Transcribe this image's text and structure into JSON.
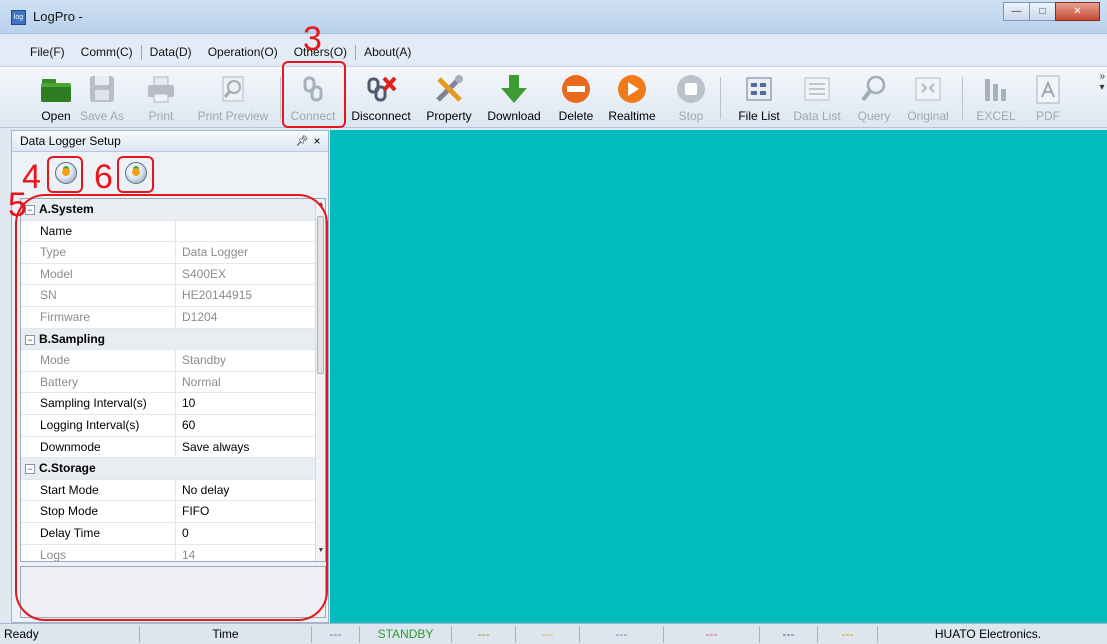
{
  "window": {
    "title": "LogPro -",
    "app_icon_text": "log"
  },
  "menu": [
    "File(F)",
    "Comm(C)",
    "Data(D)",
    "Operation(O)",
    "Others(O)",
    "About(A)"
  ],
  "toolbar": {
    "open": "Open",
    "save_as": "Save As",
    "print": "Print",
    "print_preview": "Print Preview",
    "connect": "Connect",
    "disconnect": "Disconnect",
    "property": "Property",
    "download": "Download",
    "delete": "Delete",
    "realtime": "Realtime",
    "stop": "Stop",
    "file_list": "File List",
    "data_list": "Data List",
    "query": "Query",
    "original": "Original",
    "excel": "EXCEL",
    "pdf": "PDF"
  },
  "panel": {
    "title": "Data Logger Setup"
  },
  "grid": {
    "rows": [
      {
        "k": "A.System",
        "cat": true
      },
      {
        "k": "Name",
        "v": ""
      },
      {
        "k": "Type",
        "v": "Data Logger",
        "ro": true
      },
      {
        "k": "Model",
        "v": "S400EX",
        "ro": true
      },
      {
        "k": "SN",
        "v": "HE20144915",
        "ro": true
      },
      {
        "k": "Firmware",
        "v": "D1204",
        "ro": true
      },
      {
        "k": "B.Sampling",
        "cat": true
      },
      {
        "k": "Mode",
        "v": "Standby",
        "ro": true
      },
      {
        "k": "Battery",
        "v": "Normal",
        "ro": true
      },
      {
        "k": "Sampling Interval(s)",
        "v": "10"
      },
      {
        "k": "Logging Interval(s)",
        "v": "60"
      },
      {
        "k": "Downmode",
        "v": "Save always"
      },
      {
        "k": "C.Storage",
        "cat": true
      },
      {
        "k": "Start Mode",
        "v": "No delay"
      },
      {
        "k": "Stop Mode",
        "v": "FIFO"
      },
      {
        "k": "Delay Time",
        "v": "0"
      },
      {
        "k": "Logs",
        "v": "14",
        "ro": true
      }
    ]
  },
  "status": {
    "ready": "Ready",
    "time": "Time",
    "d1": "---",
    "standby": "STANDBY",
    "d2": "---",
    "d3": "---",
    "d4": "---",
    "d5": "---",
    "d6": "---",
    "d7": "---",
    "company": "HUATO Electronics."
  },
  "annotations": {
    "n3": "3",
    "n4": "4",
    "n5": "5",
    "n6": "6"
  },
  "colors": {
    "main_bg": "#00bcbc",
    "annotation": "#e6161c",
    "standby": "#2e9a2e"
  }
}
